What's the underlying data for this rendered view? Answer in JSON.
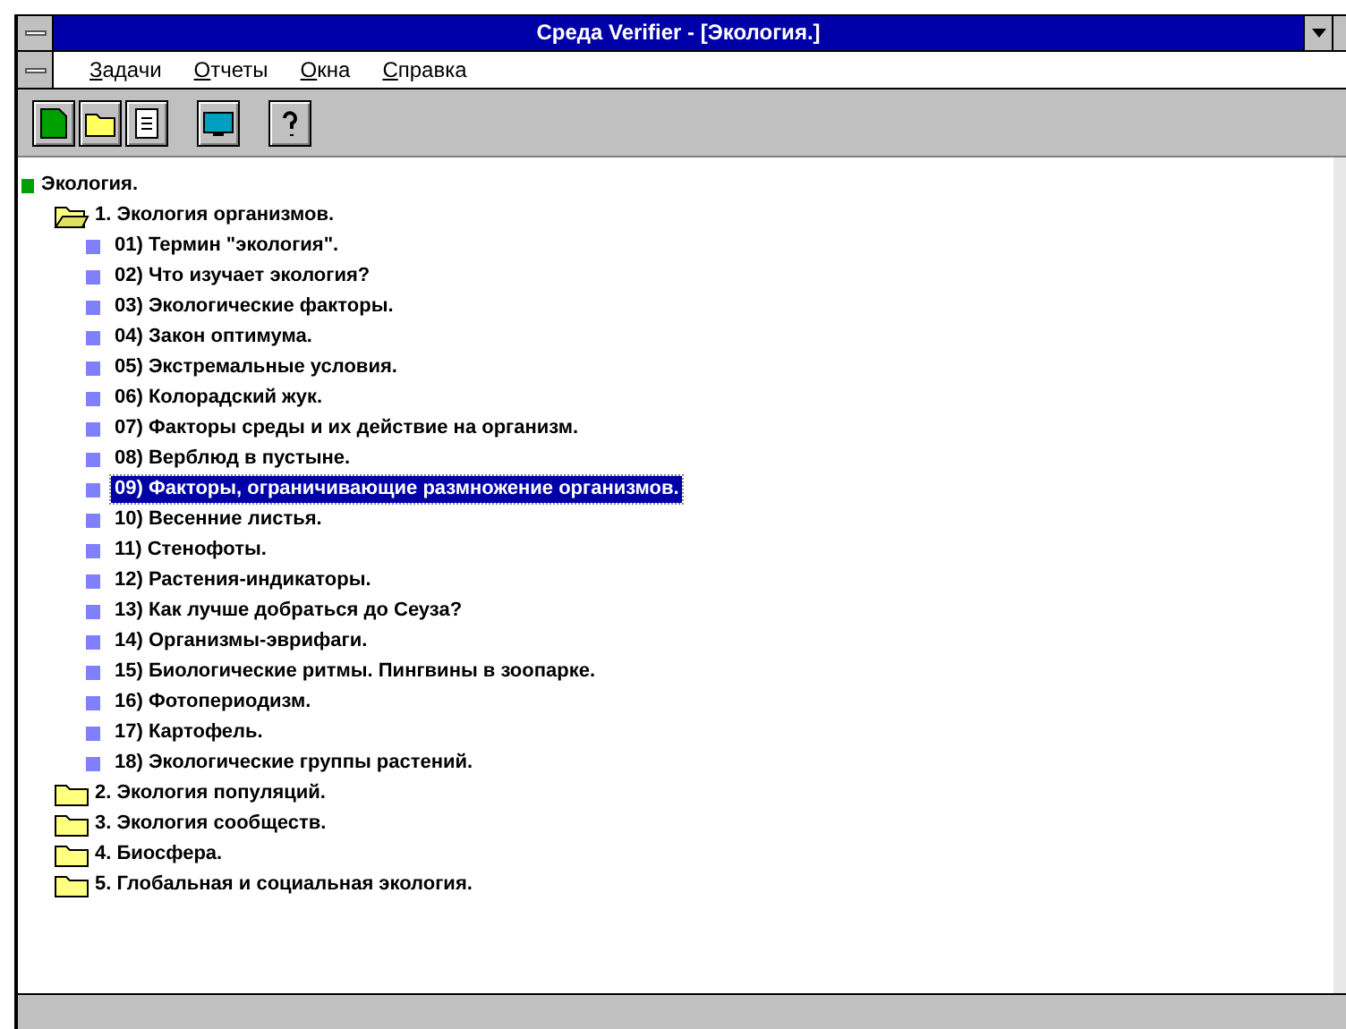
{
  "window": {
    "title": "Среда Verifier - [Экология.]"
  },
  "menu": [
    {
      "label": "Задачи"
    },
    {
      "label": "Отчеты"
    },
    {
      "label": "Окна"
    },
    {
      "label": "Справка"
    }
  ],
  "tree": [
    {
      "label": "Экология.",
      "kind": "root",
      "selected": false,
      "children": [
        {
          "label": "1. Экология организмов.",
          "kind": "folder",
          "expanded": true,
          "selected": false,
          "children": [
            {
              "label": "01) Термин \"экология\".",
              "kind": "topic",
              "selected": false
            },
            {
              "label": "02) Что изучает экология?",
              "kind": "topic",
              "selected": false
            },
            {
              "label": "03) Экологические факторы.",
              "kind": "topic",
              "selected": false
            },
            {
              "label": "04) Закон оптимума.",
              "kind": "topic",
              "selected": false
            },
            {
              "label": "05) Экстремальные условия.",
              "kind": "topic",
              "selected": false
            },
            {
              "label": "06) Колорадский жук.",
              "kind": "topic",
              "selected": false
            },
            {
              "label": "07) Факторы среды и их действие на организм.",
              "kind": "topic",
              "selected": false
            },
            {
              "label": "08) Верблюд в пустыне.",
              "kind": "topic",
              "selected": false
            },
            {
              "label": "09) Факторы, ограничивающие размножение организмов.",
              "kind": "topic",
              "selected": true
            },
            {
              "label": "10) Весенние листья.",
              "kind": "topic",
              "selected": false
            },
            {
              "label": "11) Стенофоты.",
              "kind": "topic",
              "selected": false
            },
            {
              "label": "12) Растения-индикаторы.",
              "kind": "topic",
              "selected": false
            },
            {
              "label": "13) Как лучше добраться до Сеуза?",
              "kind": "topic",
              "selected": false
            },
            {
              "label": "14) Организмы-эврифаги.",
              "kind": "topic",
              "selected": false
            },
            {
              "label": "15) Биологические ритмы. Пингвины в зоопарке.",
              "kind": "topic",
              "selected": false
            },
            {
              "label": "16) Фотопериодизм.",
              "kind": "topic",
              "selected": false
            },
            {
              "label": "17) Картофель.",
              "kind": "topic",
              "selected": false
            },
            {
              "label": "18) Экологические группы растений.",
              "kind": "topic",
              "selected": false
            }
          ]
        },
        {
          "label": "2. Экология популяций.",
          "kind": "folder",
          "expanded": false,
          "selected": false
        },
        {
          "label": "3. Экология сообществ.",
          "kind": "folder",
          "expanded": false,
          "selected": false
        },
        {
          "label": "4. Биосфера.",
          "kind": "folder",
          "expanded": false,
          "selected": false
        },
        {
          "label": "5. Глобальная и социальная экология.",
          "kind": "folder",
          "expanded": false,
          "selected": false
        }
      ]
    }
  ]
}
